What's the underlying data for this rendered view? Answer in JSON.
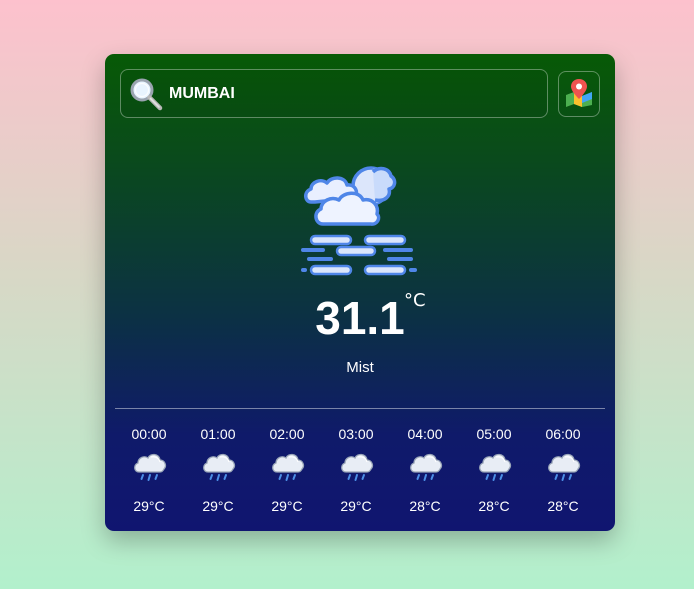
{
  "search": {
    "value": "MUMBAI",
    "placeholder": ""
  },
  "icons": {
    "search": "magnifier-icon",
    "map": "map-pin-icon",
    "current_weather": "mist-cloud-icon",
    "hourly_weather": "rain-cloud-icon"
  },
  "current": {
    "temperature": "31.1",
    "unit": "°C",
    "condition": "Mist"
  },
  "hourly": [
    {
      "time": "00:00",
      "temp": "29°C"
    },
    {
      "time": "01:00",
      "temp": "29°C"
    },
    {
      "time": "02:00",
      "temp": "29°C"
    },
    {
      "time": "03:00",
      "temp": "29°C"
    },
    {
      "time": "04:00",
      "temp": "28°C"
    },
    {
      "time": "05:00",
      "temp": "28°C"
    },
    {
      "time": "06:00",
      "temp": "28°C"
    }
  ],
  "colors": {
    "card_top": "#075a06",
    "card_bottom": "#101570",
    "page_top": "#fdc1cd",
    "page_bottom": "#b2f0cc"
  }
}
